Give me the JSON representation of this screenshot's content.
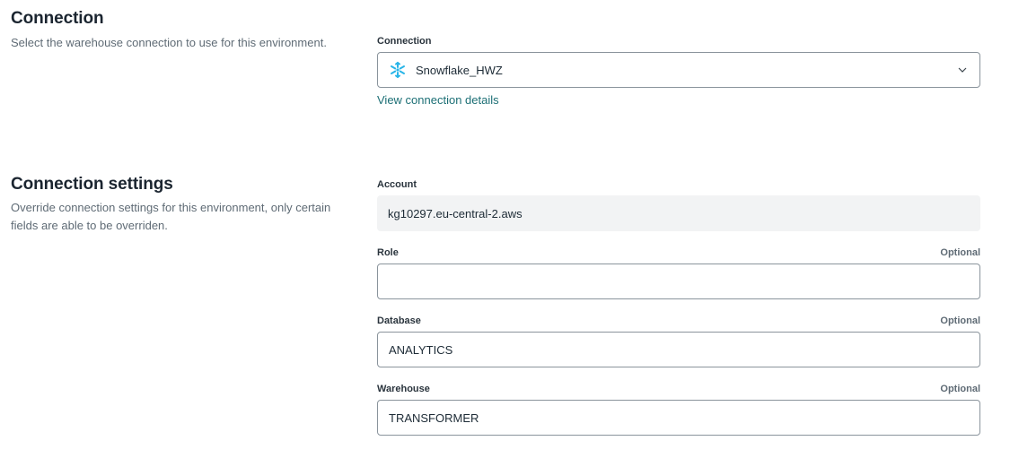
{
  "connection_section": {
    "title": "Connection",
    "description": "Select the warehouse connection to use for this environment.",
    "field_label": "Connection",
    "selected_value": "Snowflake_HWZ",
    "selected_icon": "snowflake-icon",
    "view_details_link": "View connection details"
  },
  "settings_section": {
    "title": "Connection settings",
    "description": "Override connection settings for this environment, only certain fields are able to be overriden.",
    "account": {
      "label": "Account",
      "value": "kg10297.eu-central-2.aws"
    },
    "role": {
      "label": "Role",
      "optional": "Optional",
      "value": ""
    },
    "database": {
      "label": "Database",
      "optional": "Optional",
      "value": "ANALYTICS"
    },
    "warehouse": {
      "label": "Warehouse",
      "optional": "Optional",
      "value": "TRANSFORMER"
    }
  },
  "colors": {
    "link": "#1c6f75",
    "snowflake": "#29b5e8",
    "readonly_bg": "#f2f3f4",
    "border": "#8a949c"
  }
}
